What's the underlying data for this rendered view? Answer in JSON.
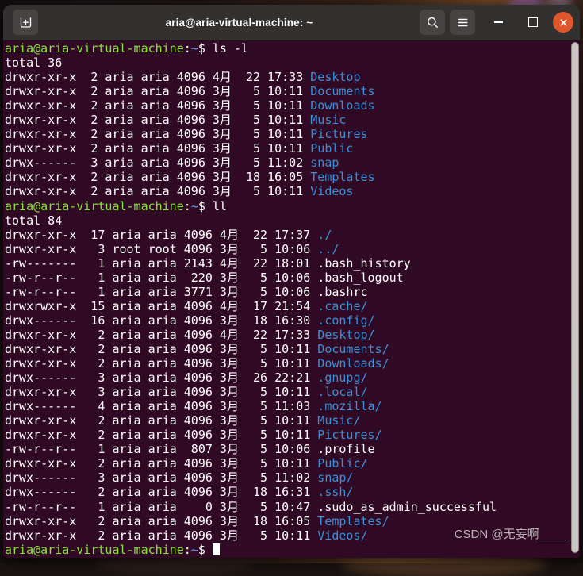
{
  "window": {
    "title": "aria@aria-virtual-machine: ~",
    "titlebar": {
      "new_tab_label": "+",
      "search_icon": "search-icon",
      "menu_icon": "hamburger-menu-icon",
      "minimize_icon": "minimize-icon",
      "maximize_icon": "maximize-icon",
      "close_icon": "close-icon"
    },
    "colors": {
      "titlebar_bg": "#333130",
      "terminal_bg": "#300a24",
      "prompt_green": "#8ae234",
      "dir_blue": "#3b8fd6",
      "text_white": "#ffffff",
      "close_red": "#e0562c",
      "scrollbar": "#c9c5c2"
    }
  },
  "watermark": "CSDN @无妄啊____",
  "terminal": {
    "prompt": {
      "user_host": "aria@aria-virtual-machine",
      "colon": ":",
      "path": "~",
      "sigil": "$"
    },
    "lines": [
      {
        "type": "prompt",
        "command": " ls -l"
      },
      {
        "type": "plain",
        "text": "total 36"
      },
      {
        "type": "entry",
        "perms": "drwxr-xr-x",
        "links": "2",
        "owner": "aria",
        "group": "aria",
        "size": "4096",
        "month": "4月",
        "day": "22",
        "time": "17:33",
        "name": "Desktop",
        "name_color": "blue"
      },
      {
        "type": "entry",
        "perms": "drwxr-xr-x",
        "links": "2",
        "owner": "aria",
        "group": "aria",
        "size": "4096",
        "month": "3月",
        "day": "5",
        "time": "10:11",
        "name": "Documents",
        "name_color": "blue"
      },
      {
        "type": "entry",
        "perms": "drwxr-xr-x",
        "links": "2",
        "owner": "aria",
        "group": "aria",
        "size": "4096",
        "month": "3月",
        "day": "5",
        "time": "10:11",
        "name": "Downloads",
        "name_color": "blue"
      },
      {
        "type": "entry",
        "perms": "drwxr-xr-x",
        "links": "2",
        "owner": "aria",
        "group": "aria",
        "size": "4096",
        "month": "3月",
        "day": "5",
        "time": "10:11",
        "name": "Music",
        "name_color": "blue"
      },
      {
        "type": "entry",
        "perms": "drwxr-xr-x",
        "links": "2",
        "owner": "aria",
        "group": "aria",
        "size": "4096",
        "month": "3月",
        "day": "5",
        "time": "10:11",
        "name": "Pictures",
        "name_color": "blue"
      },
      {
        "type": "entry",
        "perms": "drwxr-xr-x",
        "links": "2",
        "owner": "aria",
        "group": "aria",
        "size": "4096",
        "month": "3月",
        "day": "5",
        "time": "10:11",
        "name": "Public",
        "name_color": "blue"
      },
      {
        "type": "entry",
        "perms": "drwx------",
        "links": "3",
        "owner": "aria",
        "group": "aria",
        "size": "4096",
        "month": "3月",
        "day": "5",
        "time": "11:02",
        "name": "snap",
        "name_color": "blue"
      },
      {
        "type": "entry",
        "perms": "drwxr-xr-x",
        "links": "2",
        "owner": "aria",
        "group": "aria",
        "size": "4096",
        "month": "3月",
        "day": "18",
        "time": "16:05",
        "name": "Templates",
        "name_color": "blue"
      },
      {
        "type": "entry",
        "perms": "drwxr-xr-x",
        "links": "2",
        "owner": "aria",
        "group": "aria",
        "size": "4096",
        "month": "3月",
        "day": "5",
        "time": "10:11",
        "name": "Videos",
        "name_color": "blue"
      },
      {
        "type": "prompt",
        "command": " ll"
      },
      {
        "type": "plain",
        "text": "total 84"
      },
      {
        "type": "entry2",
        "perms": "drwxr-xr-x",
        "links": "17",
        "owner": "aria",
        "group": "aria",
        "size": "4096",
        "month": "4月",
        "day": "22",
        "time": "17:37",
        "name": "./",
        "name_color": "blue"
      },
      {
        "type": "entry2",
        "perms": "drwxr-xr-x",
        "links": "3",
        "owner": "root",
        "group": "root",
        "size": "4096",
        "month": "3月",
        "day": "5",
        "time": "10:06",
        "name": "../",
        "name_color": "blue"
      },
      {
        "type": "entry2",
        "perms": "-rw-------",
        "links": "1",
        "owner": "aria",
        "group": "aria",
        "size": "2143",
        "month": "4月",
        "day": "22",
        "time": "18:01",
        "name": ".bash_history",
        "name_color": "white"
      },
      {
        "type": "entry2",
        "perms": "-rw-r--r--",
        "links": "1",
        "owner": "aria",
        "group": "aria",
        "size": "220",
        "month": "3月",
        "day": "5",
        "time": "10:06",
        "name": ".bash_logout",
        "name_color": "white"
      },
      {
        "type": "entry2",
        "perms": "-rw-r--r--",
        "links": "1",
        "owner": "aria",
        "group": "aria",
        "size": "3771",
        "month": "3月",
        "day": "5",
        "time": "10:06",
        "name": ".bashrc",
        "name_color": "white"
      },
      {
        "type": "entry2",
        "perms": "drwxrwxr-x",
        "links": "15",
        "owner": "aria",
        "group": "aria",
        "size": "4096",
        "month": "4月",
        "day": "17",
        "time": "21:54",
        "name": ".cache/",
        "name_color": "blue"
      },
      {
        "type": "entry2",
        "perms": "drwx------",
        "links": "16",
        "owner": "aria",
        "group": "aria",
        "size": "4096",
        "month": "3月",
        "day": "18",
        "time": "16:30",
        "name": ".config/",
        "name_color": "blue"
      },
      {
        "type": "entry2",
        "perms": "drwxr-xr-x",
        "links": "2",
        "owner": "aria",
        "group": "aria",
        "size": "4096",
        "month": "4月",
        "day": "22",
        "time": "17:33",
        "name": "Desktop/",
        "name_color": "blue"
      },
      {
        "type": "entry2",
        "perms": "drwxr-xr-x",
        "links": "2",
        "owner": "aria",
        "group": "aria",
        "size": "4096",
        "month": "3月",
        "day": "5",
        "time": "10:11",
        "name": "Documents/",
        "name_color": "blue"
      },
      {
        "type": "entry2",
        "perms": "drwxr-xr-x",
        "links": "2",
        "owner": "aria",
        "group": "aria",
        "size": "4096",
        "month": "3月",
        "day": "5",
        "time": "10:11",
        "name": "Downloads/",
        "name_color": "blue"
      },
      {
        "type": "entry2",
        "perms": "drwx------",
        "links": "3",
        "owner": "aria",
        "group": "aria",
        "size": "4096",
        "month": "3月",
        "day": "26",
        "time": "22:21",
        "name": ".gnupg/",
        "name_color": "blue"
      },
      {
        "type": "entry2",
        "perms": "drwxr-xr-x",
        "links": "3",
        "owner": "aria",
        "group": "aria",
        "size": "4096",
        "month": "3月",
        "day": "5",
        "time": "10:11",
        "name": ".local/",
        "name_color": "blue"
      },
      {
        "type": "entry2",
        "perms": "drwx------",
        "links": "4",
        "owner": "aria",
        "group": "aria",
        "size": "4096",
        "month": "3月",
        "day": "5",
        "time": "11:03",
        "name": ".mozilla/",
        "name_color": "blue"
      },
      {
        "type": "entry2",
        "perms": "drwxr-xr-x",
        "links": "2",
        "owner": "aria",
        "group": "aria",
        "size": "4096",
        "month": "3月",
        "day": "5",
        "time": "10:11",
        "name": "Music/",
        "name_color": "blue"
      },
      {
        "type": "entry2",
        "perms": "drwxr-xr-x",
        "links": "2",
        "owner": "aria",
        "group": "aria",
        "size": "4096",
        "month": "3月",
        "day": "5",
        "time": "10:11",
        "name": "Pictures/",
        "name_color": "blue"
      },
      {
        "type": "entry2",
        "perms": "-rw-r--r--",
        "links": "1",
        "owner": "aria",
        "group": "aria",
        "size": "807",
        "month": "3月",
        "day": "5",
        "time": "10:06",
        "name": ".profile",
        "name_color": "white"
      },
      {
        "type": "entry2",
        "perms": "drwxr-xr-x",
        "links": "2",
        "owner": "aria",
        "group": "aria",
        "size": "4096",
        "month": "3月",
        "day": "5",
        "time": "10:11",
        "name": "Public/",
        "name_color": "blue"
      },
      {
        "type": "entry2",
        "perms": "drwx------",
        "links": "3",
        "owner": "aria",
        "group": "aria",
        "size": "4096",
        "month": "3月",
        "day": "5",
        "time": "11:02",
        "name": "snap/",
        "name_color": "blue"
      },
      {
        "type": "entry2",
        "perms": "drwx------",
        "links": "2",
        "owner": "aria",
        "group": "aria",
        "size": "4096",
        "month": "3月",
        "day": "18",
        "time": "16:31",
        "name": ".ssh/",
        "name_color": "blue"
      },
      {
        "type": "entry2",
        "perms": "-rw-r--r--",
        "links": "1",
        "owner": "aria",
        "group": "aria",
        "size": "0",
        "month": "3月",
        "day": "5",
        "time": "10:47",
        "name": ".sudo_as_admin_successful",
        "name_color": "white"
      },
      {
        "type": "entry2",
        "perms": "drwxr-xr-x",
        "links": "2",
        "owner": "aria",
        "group": "aria",
        "size": "4096",
        "month": "3月",
        "day": "18",
        "time": "16:05",
        "name": "Templates/",
        "name_color": "blue"
      },
      {
        "type": "entry2",
        "perms": "drwxr-xr-x",
        "links": "2",
        "owner": "aria",
        "group": "aria",
        "size": "4096",
        "month": "3月",
        "day": "5",
        "time": "10:11",
        "name": "Videos/",
        "name_color": "blue"
      },
      {
        "type": "prompt",
        "command": "",
        "cursor": true
      }
    ]
  }
}
